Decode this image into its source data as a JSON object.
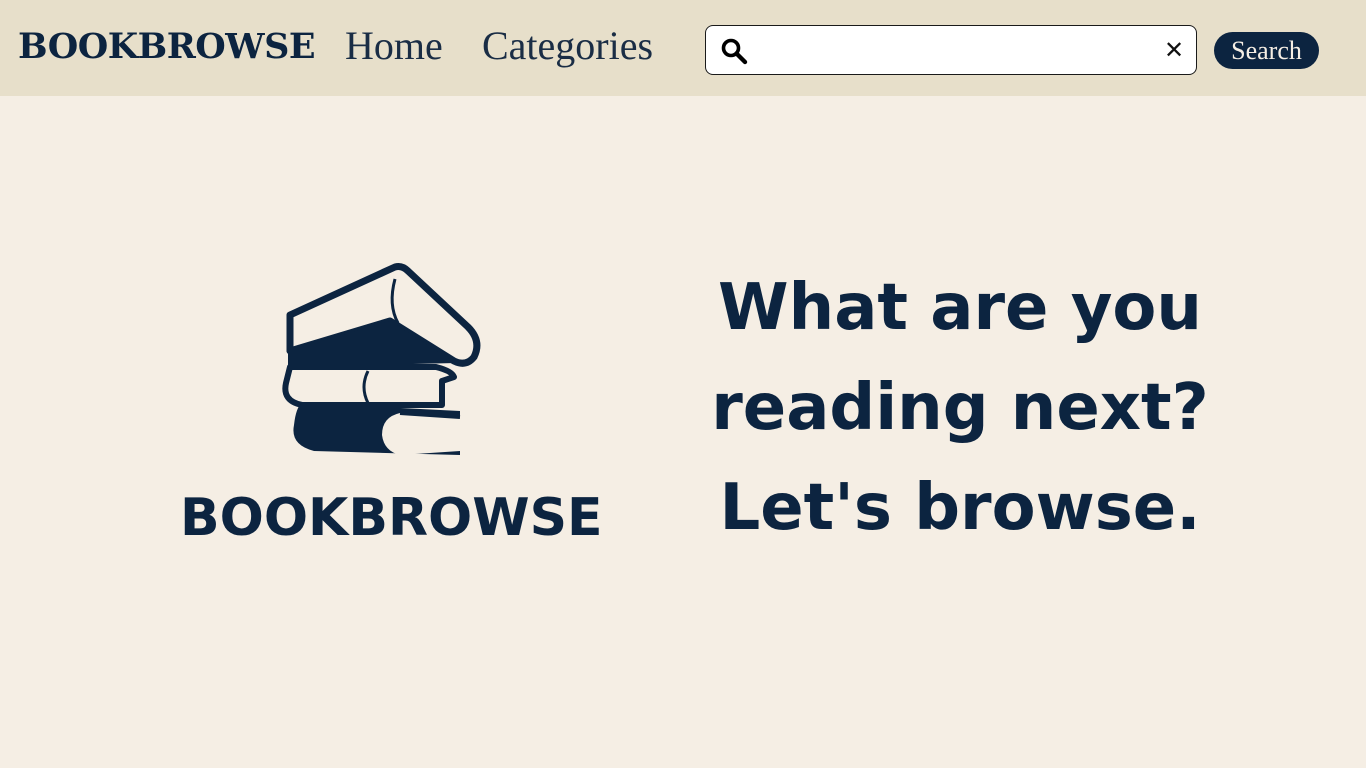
{
  "nav": {
    "brand": "BOOKBROWSE",
    "links": [
      {
        "label": "Home"
      },
      {
        "label": "Categories"
      }
    ]
  },
  "search": {
    "value": "",
    "placeholder": "",
    "clear_icon": "close-icon",
    "search_icon": "search-icon",
    "button_label": "Search"
  },
  "hero": {
    "logo_icon": "book-stack-icon",
    "logo_text": "BOOKBROWSE",
    "tagline": [
      "What are you",
      "reading next?",
      "Let's browse."
    ]
  },
  "colors": {
    "navbar_bg": "#e7dfca",
    "page_bg": "#f5eee4",
    "brand_navy": "#0c2440"
  }
}
